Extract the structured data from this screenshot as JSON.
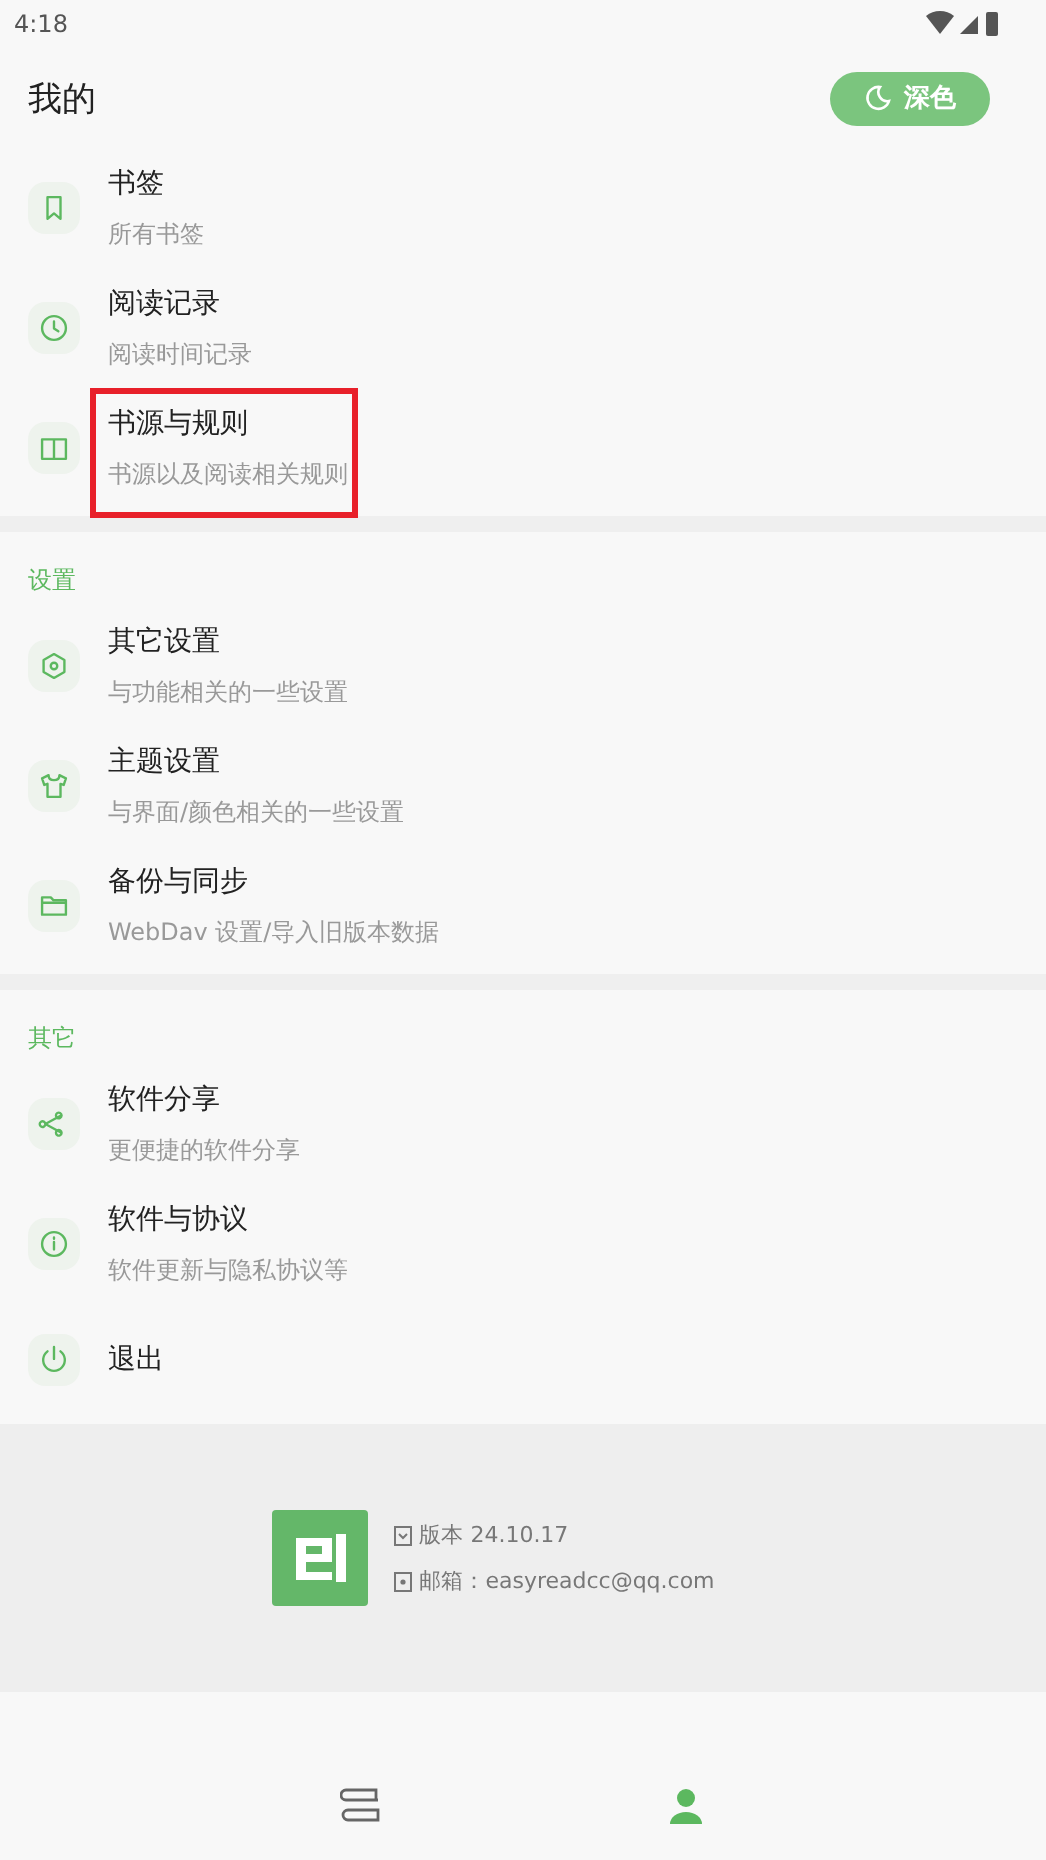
{
  "status_bar": {
    "time": "4:18"
  },
  "header": {
    "title": "我的",
    "theme_button": "深色"
  },
  "sections": [
    {
      "items": [
        {
          "title": "书签",
          "subtitle": "所有书签",
          "highlighted": false
        },
        {
          "title": "阅读记录",
          "subtitle": "阅读时间记录",
          "highlighted": false
        },
        {
          "title": "书源与规则",
          "subtitle": "书源以及阅读相关规则",
          "highlighted": true
        }
      ]
    },
    {
      "heading": "设置",
      "items": [
        {
          "title": "其它设置",
          "subtitle": "与功能相关的一些设置",
          "highlighted": false
        },
        {
          "title": "主题设置",
          "subtitle": "与界面/颜色相关的一些设置",
          "highlighted": false
        },
        {
          "title": "备份与同步",
          "subtitle": "WebDav 设置/导入旧版本数据",
          "highlighted": false
        }
      ]
    },
    {
      "heading": "其它",
      "items": [
        {
          "title": "软件分享",
          "subtitle": "更便捷的软件分享",
          "highlighted": false
        },
        {
          "title": "软件与协议",
          "subtitle": "软件更新与隐私协议等",
          "highlighted": false
        },
        {
          "title": "退出",
          "highlighted": false
        }
      ]
    }
  ],
  "footer": {
    "version": "版本 24.10.17",
    "email": "邮箱：easyreadcc@qq.com"
  },
  "bottom_nav": [
    {
      "selected": false
    },
    {
      "selected": true
    }
  ]
}
